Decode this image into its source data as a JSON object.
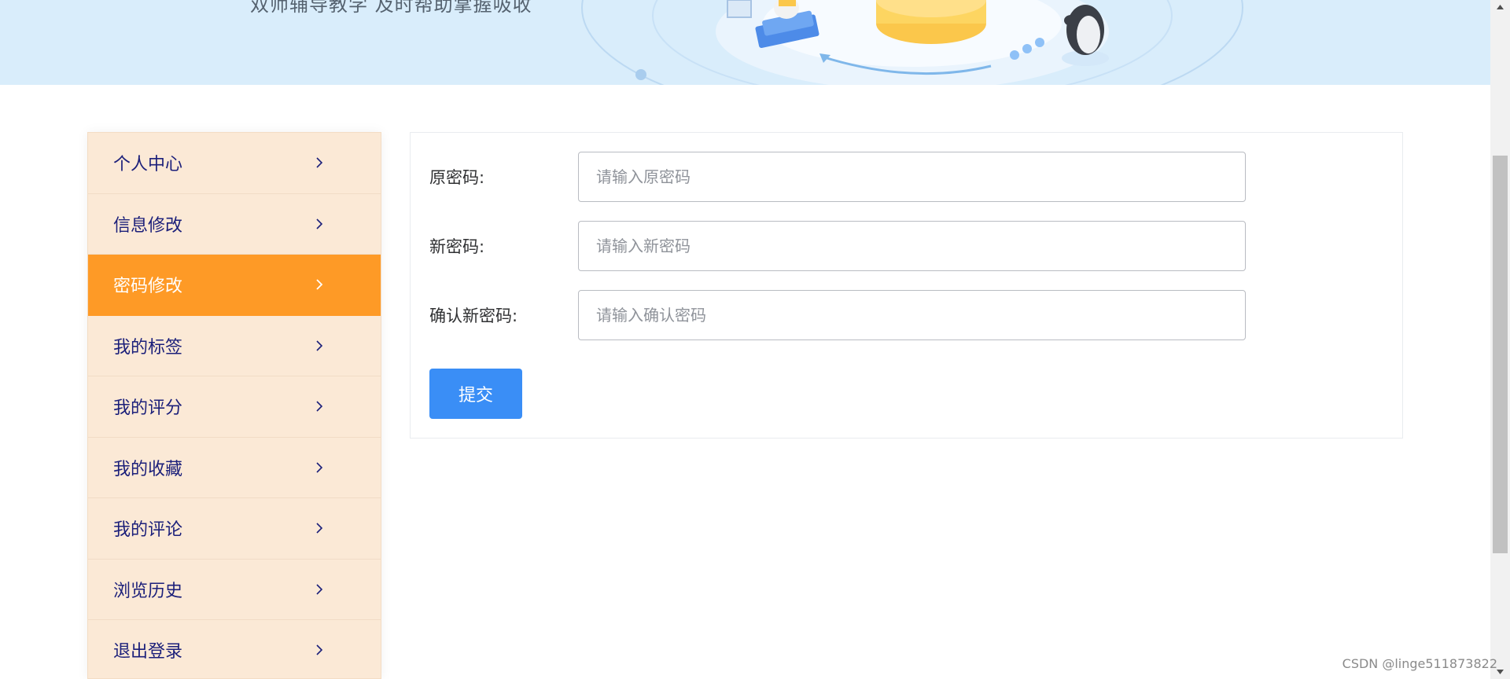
{
  "banner": {
    "slogan": "双师辅导教学 及时帮助掌握吸收"
  },
  "sidebar": {
    "items": [
      {
        "label": "个人中心",
        "active": false
      },
      {
        "label": "信息修改",
        "active": false
      },
      {
        "label": "密码修改",
        "active": true
      },
      {
        "label": "我的标签",
        "active": false
      },
      {
        "label": "我的评分",
        "active": false
      },
      {
        "label": "我的收藏",
        "active": false
      },
      {
        "label": "我的评论",
        "active": false
      },
      {
        "label": "浏览历史",
        "active": false
      },
      {
        "label": "退出登录",
        "active": false
      }
    ],
    "item_icon": "chevron-right-icon"
  },
  "form": {
    "old_password": {
      "label": "原密码:",
      "placeholder": "请输入原密码",
      "value": ""
    },
    "new_password": {
      "label": "新密码:",
      "placeholder": "请输入新密码",
      "value": ""
    },
    "confirm_password": {
      "label": "确认新密码:",
      "placeholder": "请输入确认密码",
      "value": ""
    },
    "submit_label": "提交"
  },
  "watermark": "CSDN @linge511873822",
  "colors": {
    "banner_bg": "#d9edfb",
    "sidebar_bg": "#fbe9d6",
    "sidebar_active": "#fe9a26",
    "menu_text": "#1b1f7a",
    "primary_button": "#3a8ef6"
  }
}
